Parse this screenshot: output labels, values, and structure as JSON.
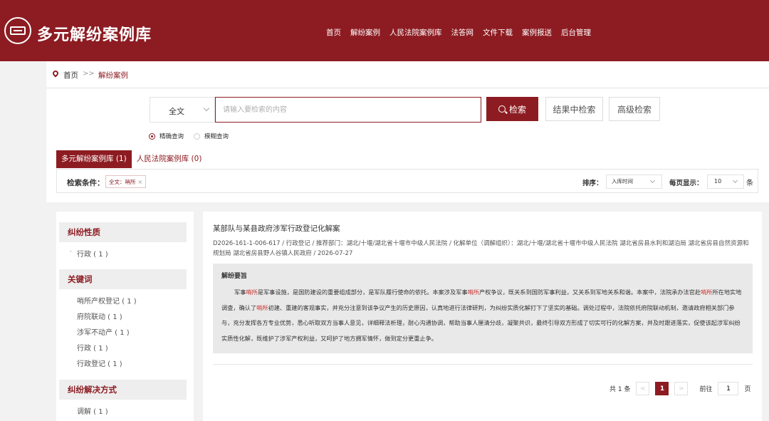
{
  "header": {
    "site_title": "多元解纷案例库",
    "nav": [
      "首页",
      "解纷案例",
      "人民法院案例库",
      "法答网",
      "文件下载",
      "案例报送",
      "后台管理"
    ]
  },
  "breadcrumb": {
    "home": "首页",
    "separator": ">>",
    "current": "解纷案例"
  },
  "search": {
    "scope": "全文",
    "placeholder": "请输入要检索的内容",
    "search_label": "检索",
    "refine_label": "结果中检索",
    "advanced_label": "高级检索",
    "mode_exact": "精确查询",
    "mode_fuzzy": "模糊查询"
  },
  "tabs": [
    "多元解纷案例库 (1)",
    "人民法院案例库 (0)"
  ],
  "conditions": {
    "label": "检索条件：",
    "tag": "全文：哨所",
    "sort_label": "排序：",
    "sort_value": "入库时间",
    "per_page_label": "每页显示：",
    "per_page_value": "10",
    "per_page_unit": "条"
  },
  "sidebar": {
    "dispute_nature": {
      "title": "纠纷性质",
      "items": [
        "行政 ( 1 )"
      ]
    },
    "keywords": {
      "title": "关键词",
      "items": [
        "哨所产权登记 ( 1 )",
        "府院联动 ( 1 )",
        "涉军不动产 ( 1 )",
        "行政 ( 1 )",
        "行政登记 ( 1 )"
      ]
    },
    "resolution": {
      "title": "纠纷解决方式",
      "items": [
        "调解 ( 1 )"
      ]
    }
  },
  "result": {
    "title": "某部队与某县政府涉军行政登记化解案",
    "meta": "D2026-161-1-006-617 / 行政登记 / 推荐部门：湖北/十堰/湖北省十堰市中级人民法院  / 化解单位（调解组织）：湖北/十堰/湖北省十堰市中级人民法院  湖北省房县水利和湖泊局  湖北省房县自然资源和规划局  湖北省房县野人谷镇人民政府  / 2026-07-27",
    "summary_title": "解纷要旨",
    "summary_parts": [
      "军事",
      "哨所",
      "是军事设施，是国防建设的重要组成部分，是军队履行使命的依托。本案涉及军事",
      "哨所",
      "产权争议，既关系到国防军事利益，又关系到军地关系和谐。本案中，法院承办法官赴",
      "哨所",
      "所在地实地调查，确认了",
      "哨所",
      "初建、重建的客观事实，并充分注意到该争议产生的历史原因，认真地进行法律研判，为纠纷实质化解打下了坚实的基础。调处过程中，法院依托府院联动机制，邀请政府相关部门参与，充分发挥各方专业优势，悉心听取双方当事人意见，详细释法析理，耐心沟通协调，帮助当事人厘清分歧，凝聚共识，最终引导双方形成了切实可行的化解方案，并及时跟进落实，促使该起涉军纠纷实质性化解，既维护了涉军产权利益，又呵护了地方拥军情怀，做到定分更重止争。"
    ]
  },
  "pagination": {
    "total": "共 1 条",
    "prev": "<",
    "current": "1",
    "next": ">",
    "goto_label": "前往",
    "goto_value": "1",
    "page_unit": "页"
  },
  "colors": {
    "brand": "#8d1c22",
    "highlight": "#c8332f"
  }
}
